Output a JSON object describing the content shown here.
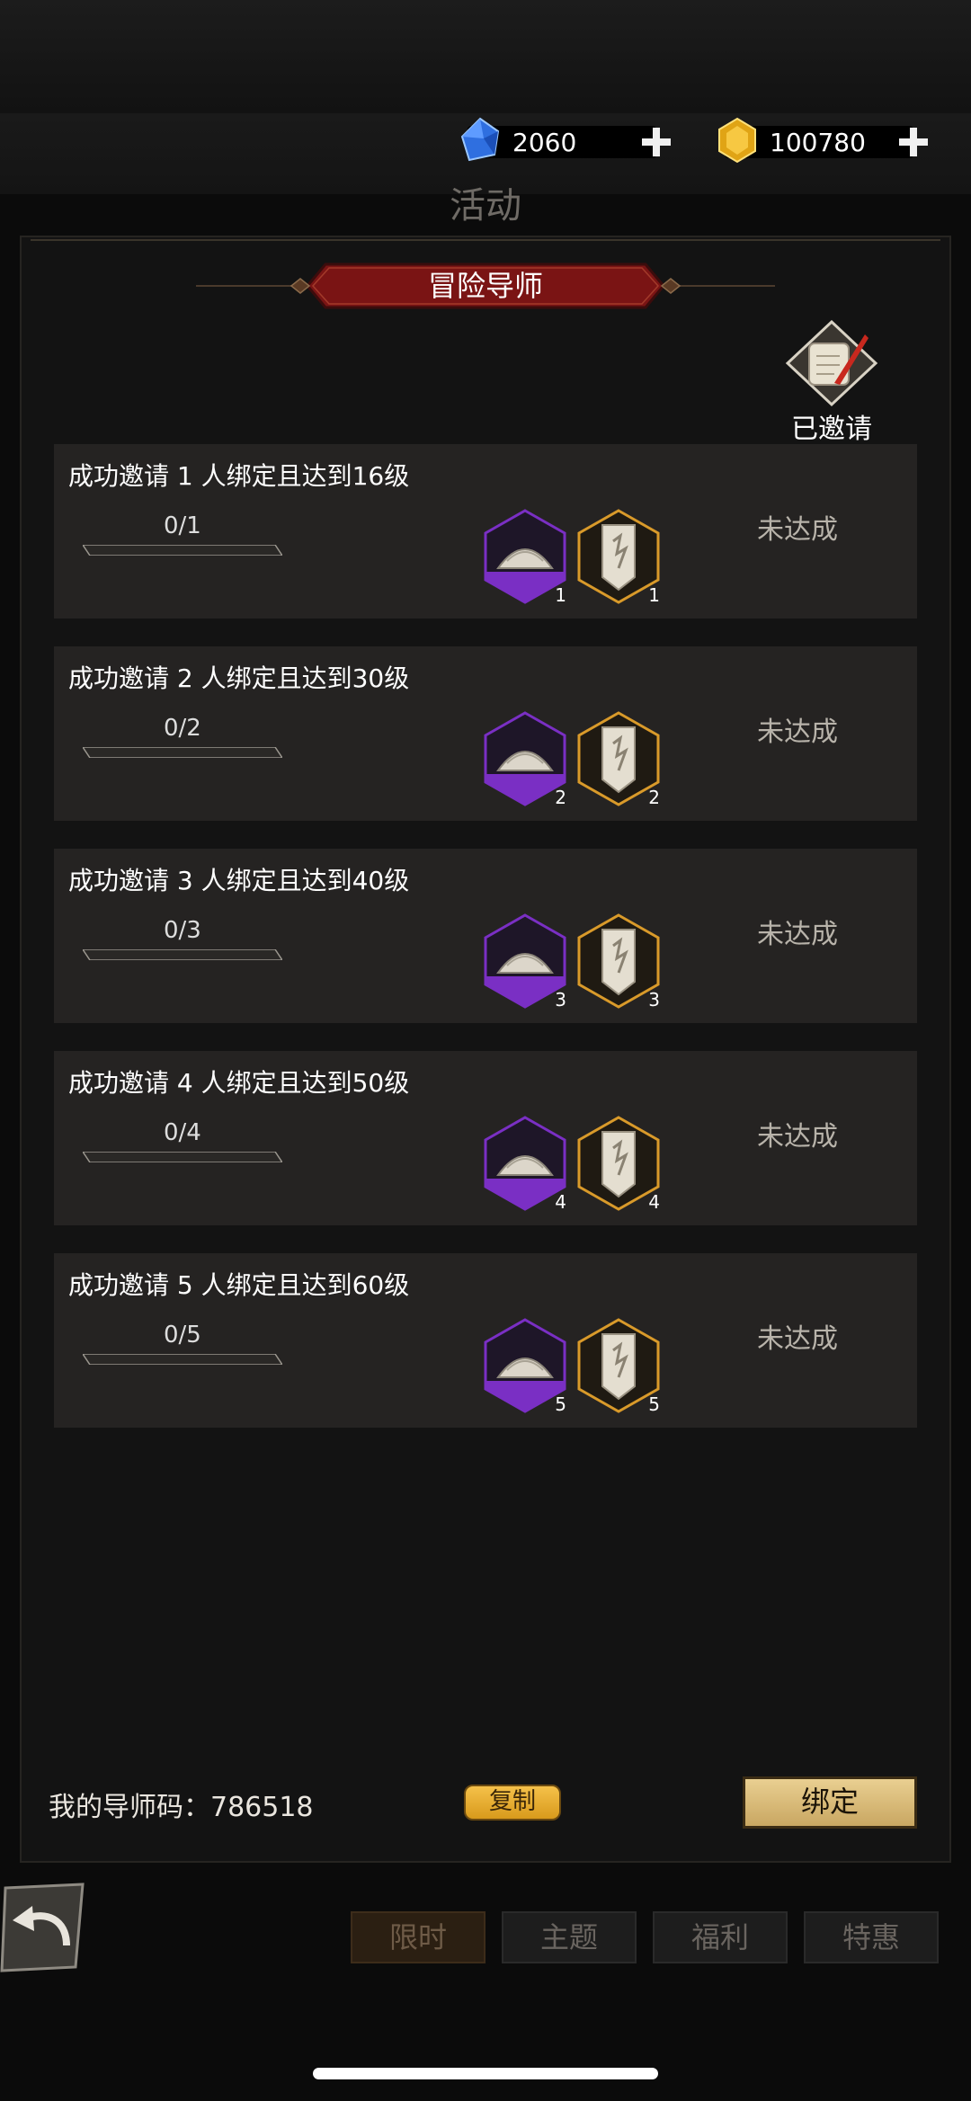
{
  "header": {
    "gems": "2060",
    "gold": "100780",
    "page_title": "活动"
  },
  "panel": {
    "title": "冒险导师",
    "invited_label": "已邀请"
  },
  "tasks": [
    {
      "title": "成功邀请 1 人绑定且达到16级",
      "progress": "0/1",
      "progress_fraction": 0,
      "status": "未达成",
      "reward_a_qty": "1",
      "reward_b_qty": "1"
    },
    {
      "title": "成功邀请 2 人绑定且达到30级",
      "progress": "0/2",
      "progress_fraction": 0,
      "status": "未达成",
      "reward_a_qty": "2",
      "reward_b_qty": "2"
    },
    {
      "title": "成功邀请 3 人绑定且达到40级",
      "progress": "0/3",
      "progress_fraction": 0,
      "status": "未达成",
      "reward_a_qty": "3",
      "reward_b_qty": "3"
    },
    {
      "title": "成功邀请 4 人绑定且达到50级",
      "progress": "0/4",
      "progress_fraction": 0,
      "status": "未达成",
      "reward_a_qty": "4",
      "reward_b_qty": "4"
    },
    {
      "title": "成功邀请 5 人绑定且达到60级",
      "progress": "0/5",
      "progress_fraction": 0,
      "status": "未达成",
      "reward_a_qty": "5",
      "reward_b_qty": "5"
    }
  ],
  "footer": {
    "mentor_code_label": "我的导师码：",
    "mentor_code": "786518",
    "copy_label": "复制",
    "bind_label": "绑定"
  },
  "tabs": [
    "限时",
    "主题",
    "福利",
    "特惠"
  ],
  "colors": {
    "banner_red": "#7a1414",
    "epic_purple": "#7a2fc4",
    "legend_gold": "#d99a2a",
    "button_gold": "#e9cf91"
  }
}
